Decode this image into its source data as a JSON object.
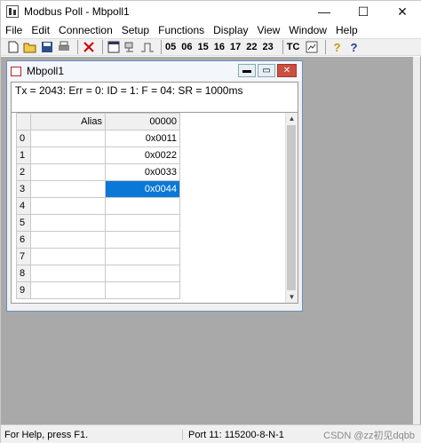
{
  "window": {
    "title": "Modbus Poll - Mbpoll1",
    "minimize": "—",
    "maximize": "☐",
    "close": "✕"
  },
  "menu": {
    "items": [
      "File",
      "Edit",
      "Connection",
      "Setup",
      "Functions",
      "Display",
      "View",
      "Window",
      "Help"
    ]
  },
  "toolbar": {
    "function_codes": [
      "05",
      "06",
      "15",
      "16",
      "17",
      "22",
      "23"
    ],
    "tc_label": "TC",
    "help_glyph": "?",
    "whatsthis_glyph": "?"
  },
  "child": {
    "title": "Mbpoll1",
    "status_line": "Tx = 2043: Err = 0: ID = 1: F = 04: SR = 1000ms",
    "columns": {
      "alias": "Alias",
      "address": "00000"
    },
    "rows": [
      {
        "num": "0",
        "alias": "",
        "value": "0x0011"
      },
      {
        "num": "1",
        "alias": "",
        "value": "0x0022"
      },
      {
        "num": "2",
        "alias": "",
        "value": "0x0033"
      },
      {
        "num": "3",
        "alias": "",
        "value": "0x0044"
      },
      {
        "num": "4",
        "alias": "",
        "value": ""
      },
      {
        "num": "5",
        "alias": "",
        "value": ""
      },
      {
        "num": "6",
        "alias": "",
        "value": ""
      },
      {
        "num": "7",
        "alias": "",
        "value": ""
      },
      {
        "num": "8",
        "alias": "",
        "value": ""
      },
      {
        "num": "9",
        "alias": "",
        "value": ""
      }
    ],
    "selected_row": 3
  },
  "statusbar": {
    "help": "For Help, press F1.",
    "port": "Port 11: 115200-8-N-1",
    "watermark": "CSDN @zz初见dqbb"
  },
  "colors": {
    "selection": "#0a78d7",
    "mdi_background": "#a9a9a9"
  }
}
